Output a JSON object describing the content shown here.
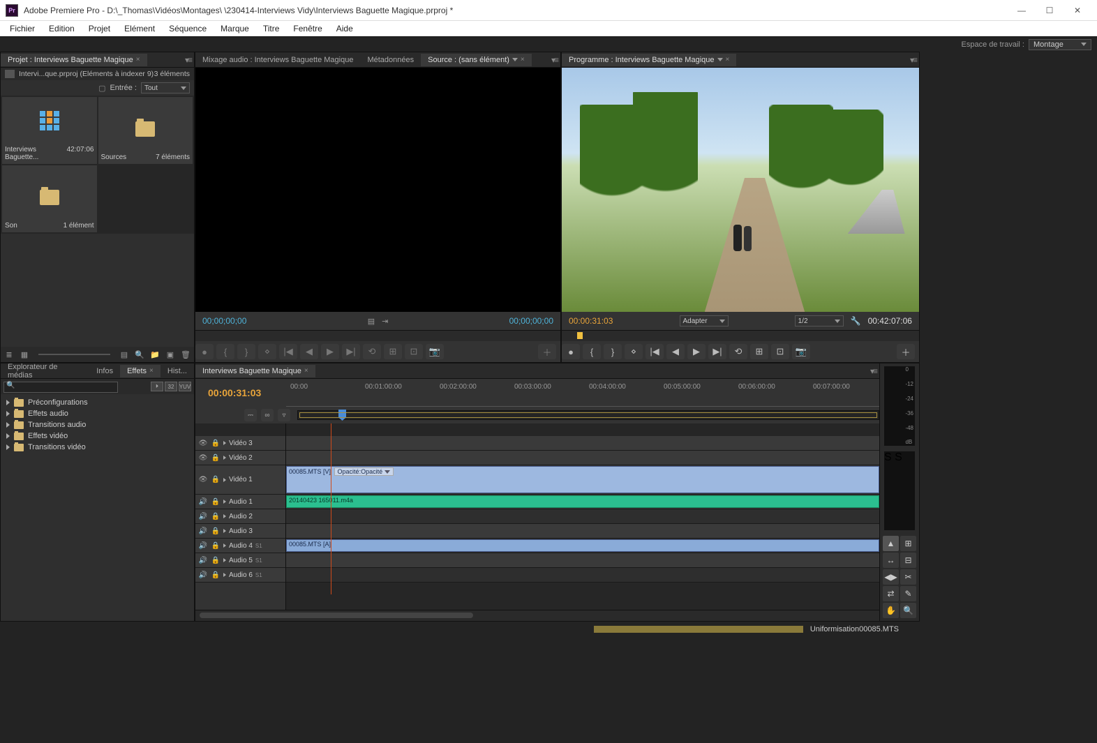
{
  "titlebar": {
    "app": "Adobe Premiere Pro",
    "path": "D:\\_Thomas\\Vidéos\\Montages\\                          \\230414-Interviews Vidy\\Interviews Baguette Magique.prproj *"
  },
  "menu": [
    "Fichier",
    "Edition",
    "Projet",
    "Elément",
    "Séquence",
    "Marque",
    "Titre",
    "Fenêtre",
    "Aide"
  ],
  "workspace": {
    "label": "Espace de travail :",
    "value": "Montage"
  },
  "project": {
    "tab": "Projet : Interviews Baguette Magique",
    "subhead_left": "Intervi...que.prproj (Eléments à indexer 9)",
    "subhead_right": "3 éléments",
    "filter_label": "Entrée :",
    "filter_value": "Tout",
    "bins": [
      {
        "name": "Interviews Baguette...",
        "meta": "42:07:06",
        "type": "seq"
      },
      {
        "name": "Sources",
        "meta": "7 éléments",
        "type": "bin"
      },
      {
        "name": "Son",
        "meta": "1 élément",
        "type": "bin"
      }
    ]
  },
  "source": {
    "tabs": [
      "Mixage audio : Interviews Baguette Magique",
      "Métadonnées",
      "Source : (sans élément)"
    ],
    "active": 2,
    "tc_left": "00;00;00;00",
    "tc_right": "00;00;00;00"
  },
  "program": {
    "tab": "Programme : Interviews Baguette Magique",
    "tc_left": "00:00:31:03",
    "fit_label": "Adapter",
    "zoom": "1/2",
    "tc_right": "00:42:07:06"
  },
  "effects": {
    "tabs": [
      "Explorateur de médias",
      "Infos",
      "Effets",
      "Hist..."
    ],
    "active": 2,
    "search_placeholder": "",
    "badges": [
      "⏵",
      "32",
      "YUV"
    ],
    "folders": [
      "Préconfigurations",
      "Effets audio",
      "Transitions audio",
      "Effets vidéo",
      "Transitions vidéo"
    ]
  },
  "timeline": {
    "tab": "Interviews Baguette Magique",
    "timecode": "00:00:31:03",
    "ruler": [
      "00:00",
      "00:01:00:00",
      "00:02:00:00",
      "00:03:00:00",
      "00:04:00:00",
      "00:05:00:00",
      "00:06:00:00",
      "00:07:00:00"
    ],
    "video_tracks": [
      "Vidéo 3",
      "Vidéo 2",
      "Vidéo 1"
    ],
    "audio_tracks": [
      "Audio 1",
      "Audio 2",
      "Audio 3",
      "Audio 4",
      "Audio 5",
      "Audio 6"
    ],
    "v1_clip": "00085.MTS [V]",
    "v1_fx": "Opacité:Opacité",
    "a1_clip": "20140423 165011.m4a",
    "a4_clip": "00085.MTS [A]",
    "superscript": "S1"
  },
  "meters_scale": [
    "0",
    "-12",
    "-24",
    "-36",
    "-48",
    "dB"
  ],
  "tools": [
    "▲",
    "⊞",
    "↔",
    "⊟",
    "◀▶",
    "✂",
    "⇄",
    "✎",
    "✋",
    "🔍"
  ],
  "status": "Uniformisation00085.MTS"
}
